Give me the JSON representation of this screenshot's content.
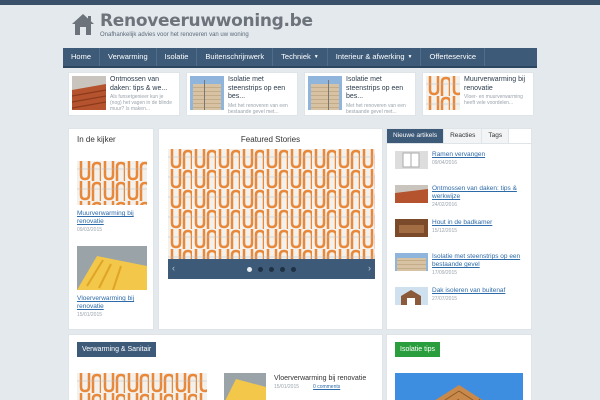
{
  "site": {
    "title": "Renoveeruwwoning.be",
    "tagline": "Onafhankelijk advies voor het renoveren van uw woning"
  },
  "nav": [
    {
      "label": "Home"
    },
    {
      "label": "Verwarming"
    },
    {
      "label": "Isolatie"
    },
    {
      "label": "Buitenschrijnwerk"
    },
    {
      "label": "Techniek",
      "dropdown": true
    },
    {
      "label": "Interieur & afwerking",
      "dropdown": true
    },
    {
      "label": "Offerteservice"
    }
  ],
  "top_strip": [
    {
      "title": "Ontmossen van daken: tips & we...",
      "excerpt": "Als funsetgenieer kun je (nog) het vagen in de blinde muur? Is maken..."
    },
    {
      "title": "Isolatie met steenstrips op een bes...",
      "excerpt": "Met het renoveren van een bestaande gevel met..."
    },
    {
      "title": "Isolatie met steenstrips op een bes...",
      "excerpt": "Met het renoveren van een bestaande gevel met..."
    },
    {
      "title": "Muurverwarming bij renovatie",
      "excerpt": "Vloer- en muurverwarming heeft vele voordelen..."
    }
  ],
  "in_de_kijker": {
    "heading": "In de kijker",
    "items": [
      {
        "title": "Muurverwarming bij renovatie",
        "date": "09/03/2015"
      },
      {
        "title": "Vloerverwarming bij renovatie",
        "date": "15/01/2015"
      }
    ]
  },
  "featured": {
    "heading": "Featured Stories",
    "slides": 5,
    "active_slide": 1
  },
  "tabs": {
    "items": [
      "Nieuwe artikels",
      "Reacties",
      "Tags"
    ],
    "active": "Nieuwe artikels",
    "articles": [
      {
        "title": "Ramen vervangen",
        "date": "09/04/2016"
      },
      {
        "title": "Ontmossen van daken: tips & werkwijze",
        "date": "24/02/2016"
      },
      {
        "title": "Hout in de badkamer",
        "date": "15/12/2015"
      },
      {
        "title": "Isolatie met steenstrips op een bestaande gevel",
        "date": "17/09/2015"
      },
      {
        "title": "Dak isoleren van buitenaf",
        "date": "27/07/2015"
      }
    ]
  },
  "section_verwarming": {
    "heading": "Verwarming & Sanitair",
    "item": {
      "title": "Vloerverwarming bij renovatie",
      "date": "15/01/2015",
      "comments": "0 comments"
    }
  },
  "section_isolatie": {
    "heading": "Isolatie tips"
  },
  "colors": {
    "nav": "#3d5a78",
    "link": "#2d6aa8",
    "green": "#2a9d3c",
    "pipe": "#e8883a"
  }
}
